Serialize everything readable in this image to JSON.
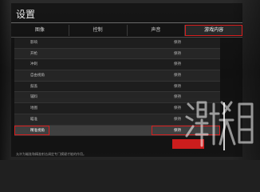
{
  "page": {
    "title": "设置"
  },
  "tabs": [
    {
      "label": "图像",
      "active": false
    },
    {
      "label": "控制",
      "active": false
    },
    {
      "label": "声音",
      "active": false
    },
    {
      "label": "游戏内容",
      "active": true
    }
  ],
  "rows": [
    {
      "label": "影响",
      "value": "保持"
    },
    {
      "label": "开枪",
      "value": "保持"
    },
    {
      "label": "冲刺",
      "value": "保持"
    },
    {
      "label": "自由视角",
      "value": "保持"
    },
    {
      "label": "鼓盖",
      "value": "保持"
    },
    {
      "label": "辅料",
      "value": "保持"
    },
    {
      "label": "地图",
      "value": "保持"
    },
    {
      "label": "瞄准",
      "value": "保持"
    },
    {
      "label": "精准视角",
      "value": "保持"
    }
  ],
  "selected_row_index": 8,
  "description": "允许为瞄准和精准射击调定专门模键才能的作用。",
  "colors": {
    "highlight_red": "#d81e1e",
    "text": "#e8e8e8",
    "row_text": "#bdbdbd"
  },
  "watermark_icon": "site-watermark-logo-icon"
}
